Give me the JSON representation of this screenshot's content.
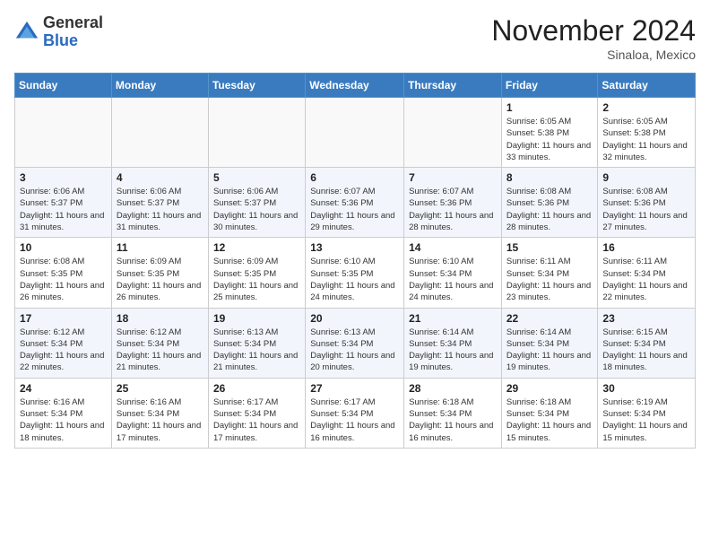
{
  "logo": {
    "general": "General",
    "blue": "Blue"
  },
  "title": "November 2024",
  "subtitle": "Sinaloa, Mexico",
  "days_of_week": [
    "Sunday",
    "Monday",
    "Tuesday",
    "Wednesday",
    "Thursday",
    "Friday",
    "Saturday"
  ],
  "weeks": [
    [
      {
        "day": "",
        "info": ""
      },
      {
        "day": "",
        "info": ""
      },
      {
        "day": "",
        "info": ""
      },
      {
        "day": "",
        "info": ""
      },
      {
        "day": "",
        "info": ""
      },
      {
        "day": "1",
        "info": "Sunrise: 6:05 AM\nSunset: 5:38 PM\nDaylight: 11 hours and 33 minutes."
      },
      {
        "day": "2",
        "info": "Sunrise: 6:05 AM\nSunset: 5:38 PM\nDaylight: 11 hours and 32 minutes."
      }
    ],
    [
      {
        "day": "3",
        "info": "Sunrise: 6:06 AM\nSunset: 5:37 PM\nDaylight: 11 hours and 31 minutes."
      },
      {
        "day": "4",
        "info": "Sunrise: 6:06 AM\nSunset: 5:37 PM\nDaylight: 11 hours and 31 minutes."
      },
      {
        "day": "5",
        "info": "Sunrise: 6:06 AM\nSunset: 5:37 PM\nDaylight: 11 hours and 30 minutes."
      },
      {
        "day": "6",
        "info": "Sunrise: 6:07 AM\nSunset: 5:36 PM\nDaylight: 11 hours and 29 minutes."
      },
      {
        "day": "7",
        "info": "Sunrise: 6:07 AM\nSunset: 5:36 PM\nDaylight: 11 hours and 28 minutes."
      },
      {
        "day": "8",
        "info": "Sunrise: 6:08 AM\nSunset: 5:36 PM\nDaylight: 11 hours and 28 minutes."
      },
      {
        "day": "9",
        "info": "Sunrise: 6:08 AM\nSunset: 5:36 PM\nDaylight: 11 hours and 27 minutes."
      }
    ],
    [
      {
        "day": "10",
        "info": "Sunrise: 6:08 AM\nSunset: 5:35 PM\nDaylight: 11 hours and 26 minutes."
      },
      {
        "day": "11",
        "info": "Sunrise: 6:09 AM\nSunset: 5:35 PM\nDaylight: 11 hours and 26 minutes."
      },
      {
        "day": "12",
        "info": "Sunrise: 6:09 AM\nSunset: 5:35 PM\nDaylight: 11 hours and 25 minutes."
      },
      {
        "day": "13",
        "info": "Sunrise: 6:10 AM\nSunset: 5:35 PM\nDaylight: 11 hours and 24 minutes."
      },
      {
        "day": "14",
        "info": "Sunrise: 6:10 AM\nSunset: 5:34 PM\nDaylight: 11 hours and 24 minutes."
      },
      {
        "day": "15",
        "info": "Sunrise: 6:11 AM\nSunset: 5:34 PM\nDaylight: 11 hours and 23 minutes."
      },
      {
        "day": "16",
        "info": "Sunrise: 6:11 AM\nSunset: 5:34 PM\nDaylight: 11 hours and 22 minutes."
      }
    ],
    [
      {
        "day": "17",
        "info": "Sunrise: 6:12 AM\nSunset: 5:34 PM\nDaylight: 11 hours and 22 minutes."
      },
      {
        "day": "18",
        "info": "Sunrise: 6:12 AM\nSunset: 5:34 PM\nDaylight: 11 hours and 21 minutes."
      },
      {
        "day": "19",
        "info": "Sunrise: 6:13 AM\nSunset: 5:34 PM\nDaylight: 11 hours and 21 minutes."
      },
      {
        "day": "20",
        "info": "Sunrise: 6:13 AM\nSunset: 5:34 PM\nDaylight: 11 hours and 20 minutes."
      },
      {
        "day": "21",
        "info": "Sunrise: 6:14 AM\nSunset: 5:34 PM\nDaylight: 11 hours and 19 minutes."
      },
      {
        "day": "22",
        "info": "Sunrise: 6:14 AM\nSunset: 5:34 PM\nDaylight: 11 hours and 19 minutes."
      },
      {
        "day": "23",
        "info": "Sunrise: 6:15 AM\nSunset: 5:34 PM\nDaylight: 11 hours and 18 minutes."
      }
    ],
    [
      {
        "day": "24",
        "info": "Sunrise: 6:16 AM\nSunset: 5:34 PM\nDaylight: 11 hours and 18 minutes."
      },
      {
        "day": "25",
        "info": "Sunrise: 6:16 AM\nSunset: 5:34 PM\nDaylight: 11 hours and 17 minutes."
      },
      {
        "day": "26",
        "info": "Sunrise: 6:17 AM\nSunset: 5:34 PM\nDaylight: 11 hours and 17 minutes."
      },
      {
        "day": "27",
        "info": "Sunrise: 6:17 AM\nSunset: 5:34 PM\nDaylight: 11 hours and 16 minutes."
      },
      {
        "day": "28",
        "info": "Sunrise: 6:18 AM\nSunset: 5:34 PM\nDaylight: 11 hours and 16 minutes."
      },
      {
        "day": "29",
        "info": "Sunrise: 6:18 AM\nSunset: 5:34 PM\nDaylight: 11 hours and 15 minutes."
      },
      {
        "day": "30",
        "info": "Sunrise: 6:19 AM\nSunset: 5:34 PM\nDaylight: 11 hours and 15 minutes."
      }
    ]
  ]
}
